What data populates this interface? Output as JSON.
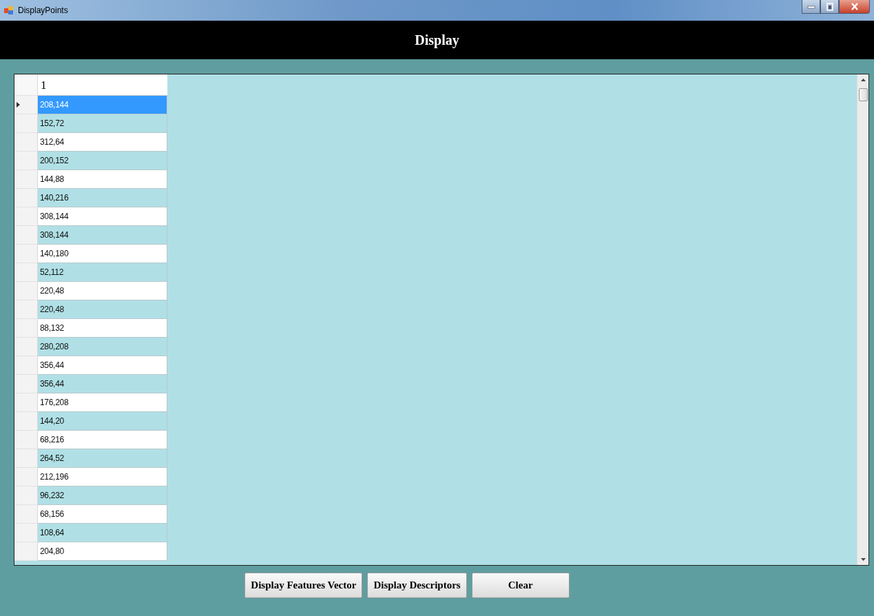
{
  "window": {
    "title": "DisplayPoints"
  },
  "header": {
    "title": "Display"
  },
  "grid": {
    "columns": [
      "1"
    ],
    "rows": [
      {
        "value": "208,144",
        "selected": true
      },
      {
        "value": "152,72",
        "selected": false
      },
      {
        "value": "312,64",
        "selected": false
      },
      {
        "value": "200,152",
        "selected": false
      },
      {
        "value": "144,88",
        "selected": false
      },
      {
        "value": "140,216",
        "selected": false
      },
      {
        "value": "308,144",
        "selected": false
      },
      {
        "value": "308,144",
        "selected": false
      },
      {
        "value": "140,180",
        "selected": false
      },
      {
        "value": "52,112",
        "selected": false
      },
      {
        "value": "220,48",
        "selected": false
      },
      {
        "value": "220,48",
        "selected": false
      },
      {
        "value": "88,132",
        "selected": false
      },
      {
        "value": "280,208",
        "selected": false
      },
      {
        "value": "356,44",
        "selected": false
      },
      {
        "value": "356,44",
        "selected": false
      },
      {
        "value": "176,208",
        "selected": false
      },
      {
        "value": "144,20",
        "selected": false
      },
      {
        "value": "68,216",
        "selected": false
      },
      {
        "value": "264,52",
        "selected": false
      },
      {
        "value": "212,196",
        "selected": false
      },
      {
        "value": "96,232",
        "selected": false
      },
      {
        "value": "68,156",
        "selected": false
      },
      {
        "value": "108,64",
        "selected": false
      },
      {
        "value": "204,80",
        "selected": false
      }
    ]
  },
  "buttons": [
    "Display Features Vector",
    "Display Descriptors",
    "Clear"
  ]
}
